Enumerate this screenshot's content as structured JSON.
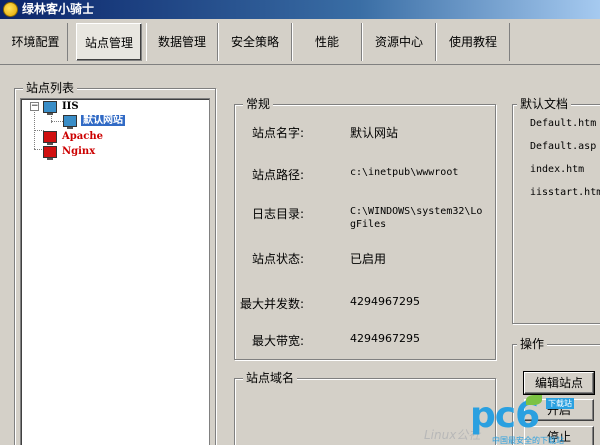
{
  "window": {
    "title": "绿林客小骑士"
  },
  "tabs": [
    {
      "label": "环境配置",
      "active": false
    },
    {
      "label": "站点管理",
      "active": true
    },
    {
      "label": "数据管理",
      "active": false
    },
    {
      "label": "安全策略",
      "active": false
    },
    {
      "label": "性能",
      "active": false
    },
    {
      "label": "资源中心",
      "active": false
    },
    {
      "label": "使用教程",
      "active": false
    }
  ],
  "site_list": {
    "title": "站点列表",
    "tree": {
      "root": "IIS",
      "root_child": "默认网站",
      "apache": "Apache",
      "nginx": "Nginx"
    }
  },
  "general": {
    "title": "常规",
    "fields": [
      {
        "label": "站点名字:",
        "value": "默认网站"
      },
      {
        "label": "站点路径:",
        "value": "c:\\inetpub\\wwwroot"
      },
      {
        "label": "日志目录:",
        "value": "C:\\WINDOWS\\system32\\LogFiles"
      },
      {
        "label": "站点状态:",
        "value": "已启用"
      },
      {
        "label": "最大并发数:",
        "value": "4294967295"
      },
      {
        "label": "最大带宽:",
        "value": "4294967295"
      }
    ]
  },
  "domain_group": {
    "title": "站点域名"
  },
  "default_docs": {
    "title": "默认文档",
    "items": [
      "Default.htm",
      "Default.asp",
      "index.htm",
      "iisstart.htm"
    ]
  },
  "operations": {
    "title": "操作",
    "buttons": [
      "编辑站点",
      "开启",
      "停止"
    ]
  },
  "watermark": {
    "logo": "pc6",
    "site": "下载站",
    "sub": "中国最安全的下载站",
    "ghost": "Linux公社"
  }
}
